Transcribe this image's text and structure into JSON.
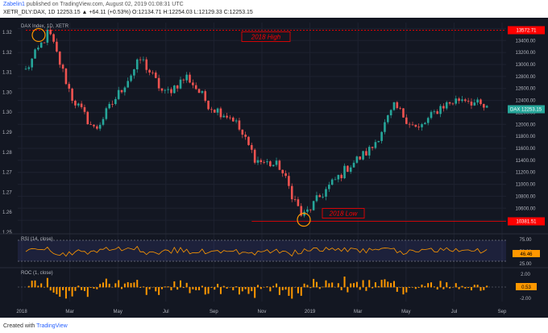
{
  "header": {
    "publisher": "Zabelin1",
    "published_text": "published on TradingView.com, August 02, 2019 01:08:31 UTC",
    "symbol_line": "XETR_DLY:DAX, 1D  12253.15 ▲ +64.11 (+0.53%) O:12134.71 H:12254.03 L:12129.33 C:12253.15"
  },
  "footer": {
    "prefix": "Created with",
    "brand": "TradingView"
  },
  "colors": {
    "bg": "#131722",
    "up": "#26a69a",
    "down": "#ef5350",
    "grid": "#1e2230",
    "axis_text": "#b2b5be",
    "rsi_line": "#ff9800",
    "roc": "#ff9800",
    "ref_line": "#ff0000",
    "circle": "#ff9800"
  },
  "chart_data": {
    "type": "candlestick",
    "symbol_label": "DAX Index, 1D, XETR",
    "left_axis": {
      "ticks": [
        "1.32",
        "1.32",
        "1.31",
        "1.30",
        "1.30",
        "1.29",
        "1.28",
        "1.27",
        "1.27",
        "1.26",
        "1.25"
      ]
    },
    "right_axis": {
      "min": 10200,
      "max": 13700,
      "ticks": [
        13600,
        13400,
        13200,
        13000,
        12800,
        12600,
        12400,
        12200,
        12000,
        11800,
        11600,
        11400,
        11200,
        11000,
        10800,
        10600,
        10400
      ]
    },
    "x_labels": [
      "2018",
      "Mar",
      "May",
      "Jul",
      "Sep",
      "Nov",
      "2019",
      "Mar",
      "May",
      "Jul",
      "Sep"
    ],
    "last_price": {
      "label": "DAX",
      "value": "12253.15"
    },
    "levels": [
      {
        "name": "2018 High",
        "value": 13572.71,
        "label": "13572.71"
      },
      {
        "name": "2018 Low",
        "value": 10381.51,
        "label": "10381.51"
      }
    ],
    "anchors": [
      {
        "period": "2018",
        "value": 12900
      },
      {
        "period": "Jan",
        "value": 13550
      },
      {
        "period": "Feb",
        "value": 12450
      },
      {
        "period": "Mar",
        "value": 11900
      },
      {
        "period": "Apr",
        "value": 12500
      },
      {
        "period": "May",
        "value": 13100
      },
      {
        "period": "Jun",
        "value": 12500
      },
      {
        "period": "Jul",
        "value": 12800
      },
      {
        "period": "Aug",
        "value": 12300
      },
      {
        "period": "Sep",
        "value": 12100
      },
      {
        "period": "Oct",
        "value": 11400
      },
      {
        "period": "Nov",
        "value": 11300
      },
      {
        "period": "Dec",
        "value": 10450
      },
      {
        "period": "2019",
        "value": 10900
      },
      {
        "period": "Feb",
        "value": 11300
      },
      {
        "period": "Mar",
        "value": 11600
      },
      {
        "period": "Apr",
        "value": 12300
      },
      {
        "period": "May",
        "value": 11900
      },
      {
        "period": "Jun",
        "value": 12300
      },
      {
        "period": "Jul",
        "value": 12450
      },
      {
        "period": "Aug",
        "value": 12250
      }
    ],
    "rsi": {
      "label": "RSI (14, close)",
      "upper": 70,
      "lower": 30,
      "ticks": [
        "75.00",
        "50.00",
        "25.00"
      ],
      "current": "46.46"
    },
    "roc": {
      "label": "ROC (1, close)",
      "ticks": [
        "2.00",
        "-2.00"
      ],
      "current": "0.53"
    }
  }
}
